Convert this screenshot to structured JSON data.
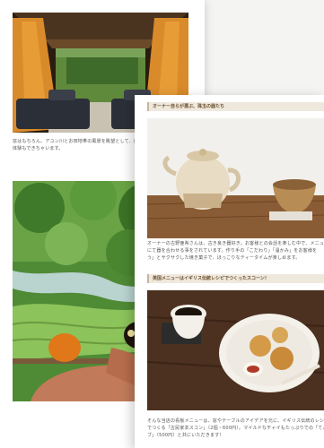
{
  "back_page": {
    "caption_1": "窓はもちろん、アユン川とお田地帯の風景を眺望として、自分",
    "caption_2": "体験もできちゃいます。"
  },
  "front_page": {
    "section_1_title": "オーナー自らが選ぶ、珠玉の器たち",
    "caption_1a": "オーナーの古野亜希さんは、古き良き器好き。お客様との会話を楽しむ中で、メニューに",
    "caption_1b": "にて器を合わせる事をされています。作り手の「こだわり」「温かみ」をお客様を",
    "caption_1c": "う」とサクサクした焼き菓子で、ほっこりなティータイムが楽しめます。",
    "section_2_title": "英国メニューはイギリス伝統レシピでつくったスコーン！",
    "caption_2a": "そんな当店の看板メニューは、窓やテーブルのアイデアを元に、イギリス伝統のレシ",
    "caption_2b": "でつくる「古民家本スコン」（2個・600円）。マイルドなチャイもたっぷりでの「てんびん屋ブ",
    "caption_2c": "ブ」（500円）と共にいただきます！"
  }
}
